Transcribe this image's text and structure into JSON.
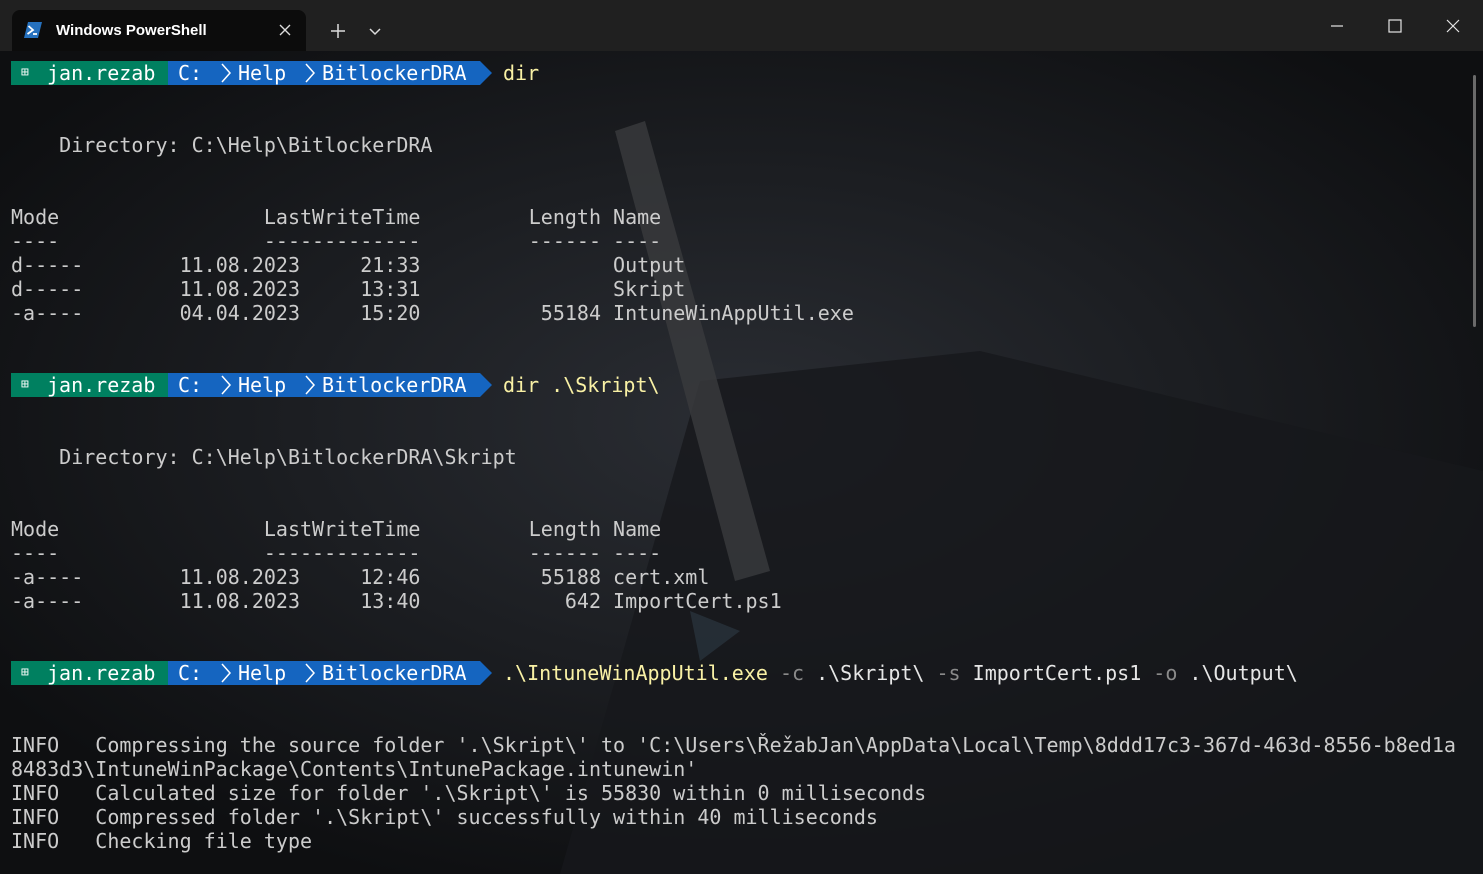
{
  "window": {
    "tab_title": "Windows PowerShell",
    "new_tab_label": "+",
    "accent_color": "#1565c0",
    "user_segment_color": "#008060"
  },
  "prompt": {
    "user": "jan.rezab",
    "drive": "C:",
    "folder1": "Help",
    "folder2": "BitlockerDRA"
  },
  "block1": {
    "command": "dir",
    "directory": "    Directory: C:\\Help\\BitlockerDRA",
    "header": "Mode                 LastWriteTime         Length Name",
    "underline": "----                 -------------         ------ ----",
    "rows": [
      "d-----        11.08.2023     21:33                Output",
      "d-----        11.08.2023     13:31                Skript",
      "-a----        04.04.2023     15:20          55184 IntuneWinAppUtil.exe"
    ]
  },
  "block2": {
    "command": "dir .\\Skript\\",
    "directory": "    Directory: C:\\Help\\BitlockerDRA\\Skript",
    "header": "Mode                 LastWriteTime         Length Name",
    "underline": "----                 -------------         ------ ----",
    "rows": [
      "-a----        11.08.2023     12:46          55188 cert.xml",
      "-a----        11.08.2023     13:40            642 ImportCert.ps1"
    ]
  },
  "block3": {
    "exe": ".\\IntuneWinAppUtil.exe",
    "flag_c": "-c",
    "arg_c": ".\\Skript\\",
    "flag_s": "-s",
    "arg_s": "ImportCert.ps1",
    "flag_o": "-o",
    "arg_o": ".\\Output\\",
    "output": [
      "INFO   Compressing the source folder '.\\Skript\\' to 'C:\\Users\\ŘežabJan\\AppData\\Local\\Temp\\8ddd17c3-367d-463d-8556-b8ed1a",
      "8483d3\\IntuneWinPackage\\Contents\\IntunePackage.intunewin'",
      "INFO   Calculated size for folder '.\\Skript\\' is 55830 within 0 milliseconds",
      "INFO   Compressed folder '.\\Skript\\' successfully within 40 milliseconds",
      "INFO   Checking file type"
    ]
  }
}
